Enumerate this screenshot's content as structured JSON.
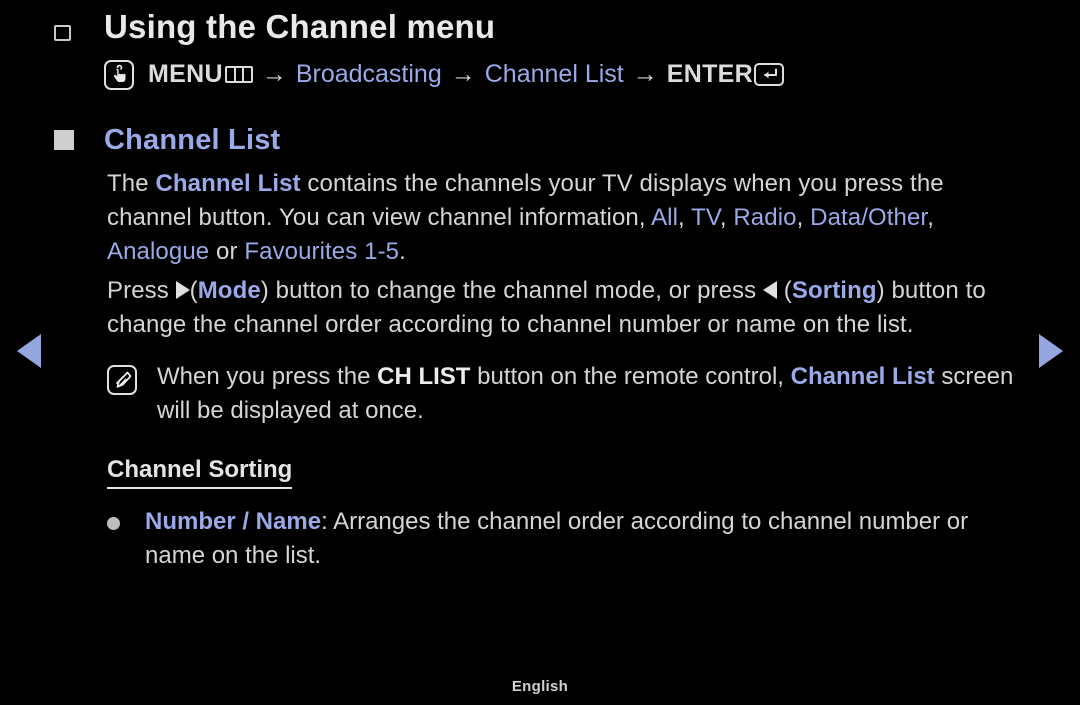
{
  "page": {
    "background_color": "#000000",
    "text_color": "#d5d5d5",
    "accent_color": "#9aa9e8",
    "footer_language": "English"
  },
  "nav": {
    "prev_label": "◀",
    "next_label": "▶",
    "prev_icon": "triangle-left-icon",
    "next_icon": "triangle-right-icon"
  },
  "heading": {
    "title": "Using the Channel menu",
    "bullet_icon": "hollow-square-bullet-icon"
  },
  "menu_path": {
    "touch_icon": "touch-hand-icon",
    "menu_label": "MENU",
    "menu_icon": "menu-bars-icon",
    "arrow1": "→",
    "step2": "Broadcasting",
    "arrow2": "→",
    "step3": "Channel List",
    "arrow3": "→",
    "enter_label": "ENTER",
    "enter_icon": "enter-return-icon"
  },
  "section": {
    "bullet_icon": "solid-square-bullet-icon",
    "title": "Channel List",
    "paragraph1": {
      "part1": "The ",
      "kw1": "Channel List",
      "part2": " contains the channels your TV displays when you press the channel button. You can view channel information, ",
      "kw_all": "All",
      "sep1": ", ",
      "kw_tv": "TV",
      "sep2": ", ",
      "kw_radio": "Radio",
      "sep3": ", ",
      "kw_data": "Data/Other",
      "sep4": ", ",
      "kw_analogue": "Analogue",
      "mid": " or ",
      "kw_fav": "Favourites 1-5",
      "end": "."
    },
    "paragraph2": {
      "part1": "Press ",
      "tri_right_icon": "triangle-right-inline-icon",
      "part2": "(",
      "kw_mode": "Mode",
      "part3": ") button to change the channel mode, or press ",
      "tri_left_icon": "triangle-left-inline-icon",
      "part4": " (",
      "kw_sorting": "Sorting",
      "part5": ") button to change the channel order according to channel number or name on the list."
    }
  },
  "note": {
    "icon": "note-pen-icon",
    "part1": "When you press the ",
    "kw_chlist": "CH LIST",
    "part2": " button on the remote control, ",
    "kw_channellist": "Channel List",
    "part3": " screen will be displayed at once."
  },
  "subsection": {
    "title": "Channel Sorting",
    "items": [
      {
        "bullet_icon": "round-dot-bullet-icon",
        "term": "Number / Name",
        "colon": ":",
        "description": " Arranges the channel order according to channel number or name on the list."
      }
    ]
  }
}
